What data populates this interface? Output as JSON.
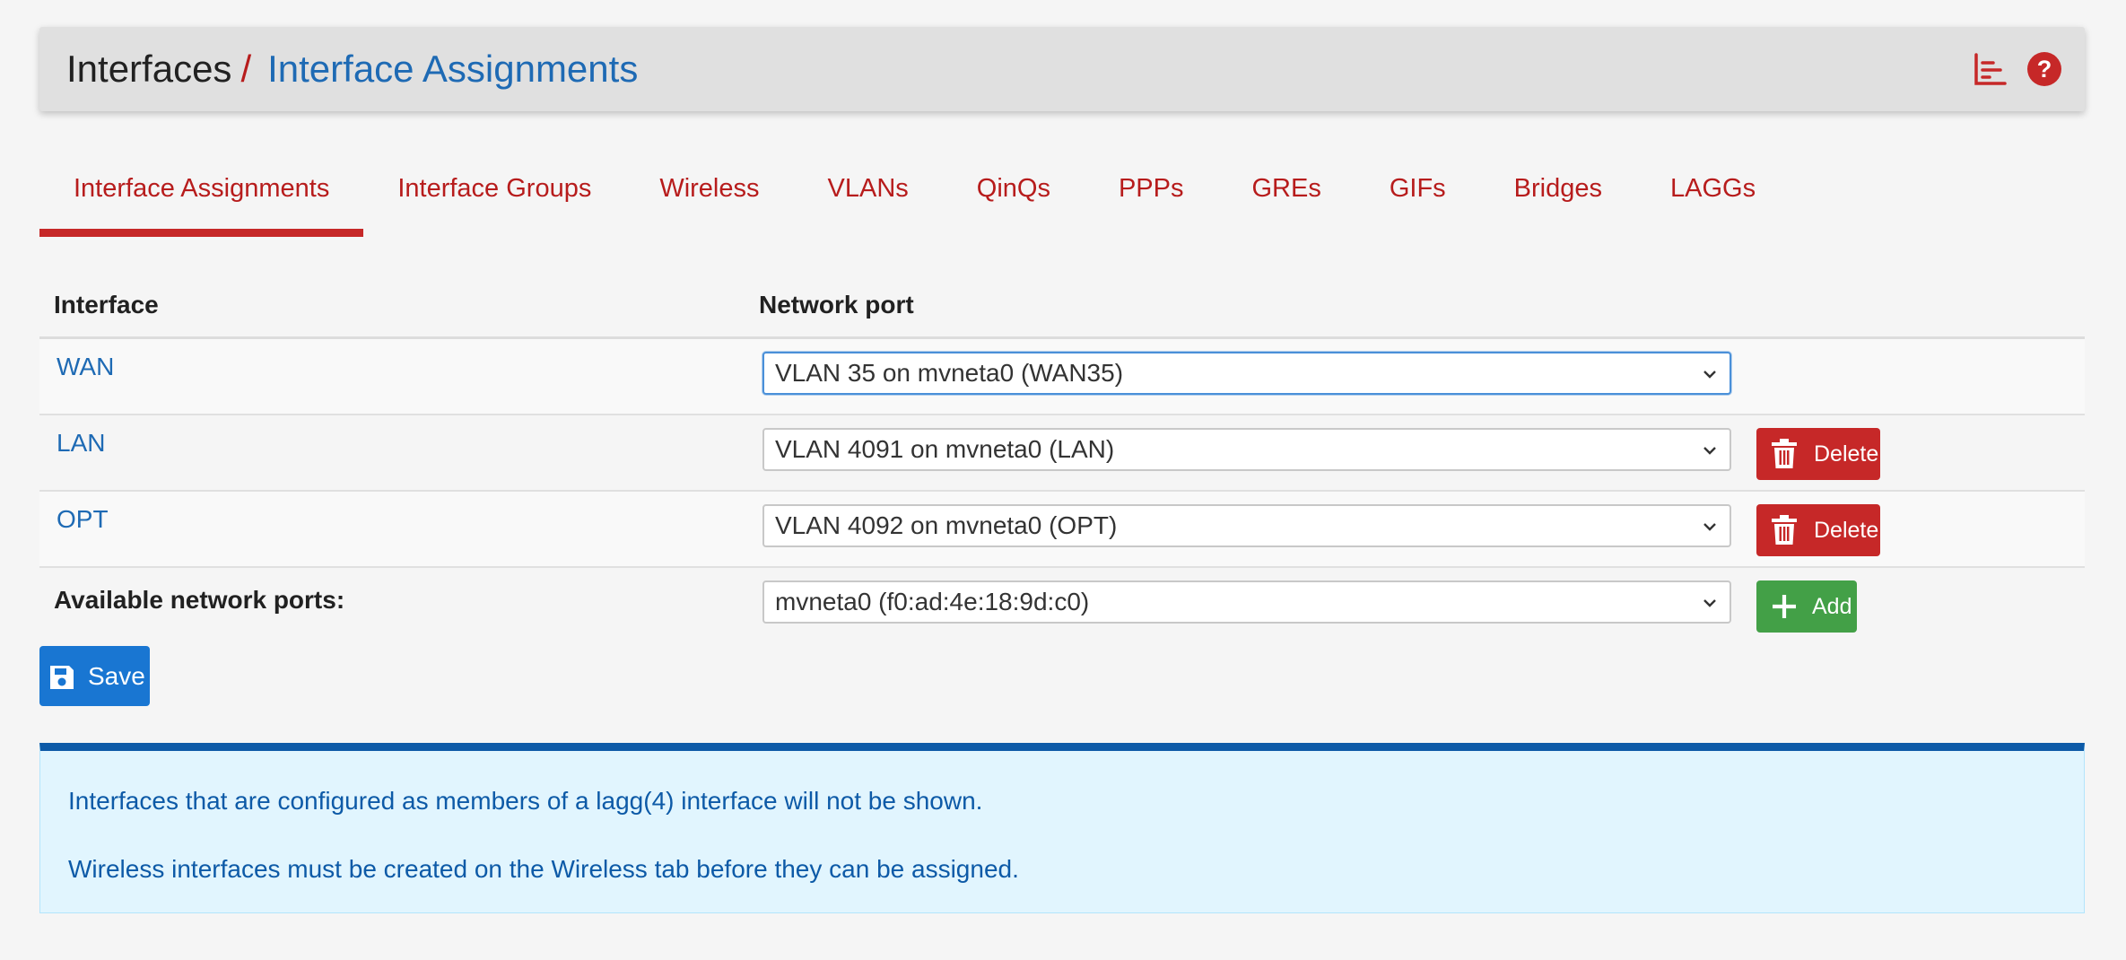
{
  "breadcrumb": {
    "root": "Interfaces",
    "separator": "/",
    "current": "Interface Assignments"
  },
  "header_icons": [
    "chart-icon",
    "help-icon"
  ],
  "help_icon_glyph": "?",
  "tabs": [
    {
      "label": "Interface Assignments",
      "active": true
    },
    {
      "label": "Interface Groups"
    },
    {
      "label": "Wireless"
    },
    {
      "label": "VLANs"
    },
    {
      "label": "QinQs"
    },
    {
      "label": "PPPs"
    },
    {
      "label": "GREs"
    },
    {
      "label": "GIFs"
    },
    {
      "label": "Bridges"
    },
    {
      "label": "LAGGs"
    }
  ],
  "table": {
    "headers": {
      "interface": "Interface",
      "network_port": "Network port"
    },
    "rows": [
      {
        "name": "WAN",
        "port": "VLAN 35 on mvneta0 (WAN35)"
      },
      {
        "name": "LAN",
        "port": "VLAN 4091 on mvneta0 (LAN)",
        "delete_label": "Delete"
      },
      {
        "name": "OPT",
        "port": "VLAN 4092 on mvneta0 (OPT)",
        "delete_label": "Delete"
      }
    ],
    "available": {
      "label": "Available network ports:",
      "port": "mvneta0 (f0:ad:4e:18:9d:c0)",
      "add_label": "Add"
    }
  },
  "save_label": "Save",
  "info": {
    "line1": "Interfaces that are configured as members of a lagg(4) interface will not be shown.",
    "line2": "Wireless interfaces must be created on the Wireless tab before they can be assigned."
  },
  "colors": {
    "accent_red": "#c62828",
    "link_blue": "#1e6ab4",
    "save_blue": "#1976d2",
    "add_green": "#43a047",
    "info_bg": "#e1f5fe",
    "info_border": "#0d5aa7"
  }
}
